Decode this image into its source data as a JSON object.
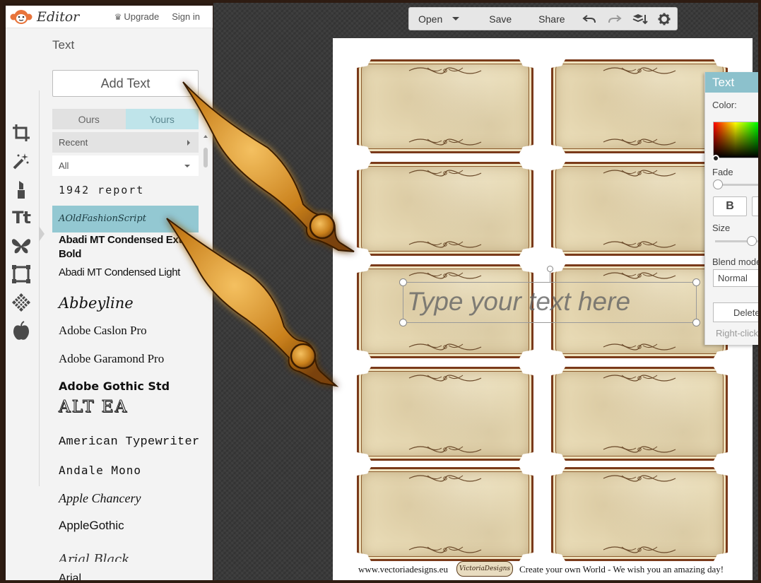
{
  "app": {
    "logo_text": "Editor",
    "upgrade_label": "Upgrade",
    "signin_label": "Sign in"
  },
  "toolbar": {
    "open_label": "Open",
    "save_label": "Save",
    "share_label": "Share",
    "icons": [
      "undo-icon",
      "redo-icon",
      "layers-icon",
      "settings-icon"
    ]
  },
  "tools": [
    "crop-icon",
    "magic-wand-icon",
    "lipstick-icon",
    "text-icon",
    "butterfly-icon",
    "frame-icon",
    "texture-icon",
    "apple-icon"
  ],
  "text_tool_label": "Tt",
  "panel": {
    "title": "Text",
    "add_text_label": "Add Text",
    "tabs": [
      {
        "label": "Ours",
        "active": false
      },
      {
        "label": "Yours",
        "active": true
      }
    ],
    "recent_label": "Recent",
    "filter_label": "All",
    "fonts": [
      "1942 report",
      "AOldFashionScript",
      "Abadi MT Condensed Extra Bold",
      "Abadi MT Condensed Light",
      "Abbeyline",
      "Adobe Caslon Pro",
      "Adobe Garamond Pro",
      "Adobe Gothic Std",
      "ALT EA",
      "American Typewriter",
      "Andale Mono",
      "Apple Chancery",
      "AppleGothic",
      "Arial Black",
      "Arial"
    ],
    "selected_font": "AOldFashionScript"
  },
  "canvas": {
    "textbox_text": "Type your text here",
    "footer_url": "www.vectoriadesigns.eu",
    "footer_badge": "VictoriaDesigns",
    "footer_message": "Create your own World - We wish you an amazing day!"
  },
  "text_properties": {
    "title": "Text",
    "color_label": "Color:",
    "fade_label": "Fade",
    "fade_value": 0,
    "bold_label": "B",
    "size_label": "Size",
    "size_value": 0.7,
    "blend_label": "Blend mode",
    "blend_value": "Normal",
    "delete_label": "Delete",
    "hint": "Right-click"
  },
  "colors": {
    "tab_active": "#bfe4ea",
    "font_highlight": "#93c8d2",
    "props_header": "#8cc1cc",
    "label_border": "#7a3a1a",
    "arrow_gold": "#e8a020"
  }
}
